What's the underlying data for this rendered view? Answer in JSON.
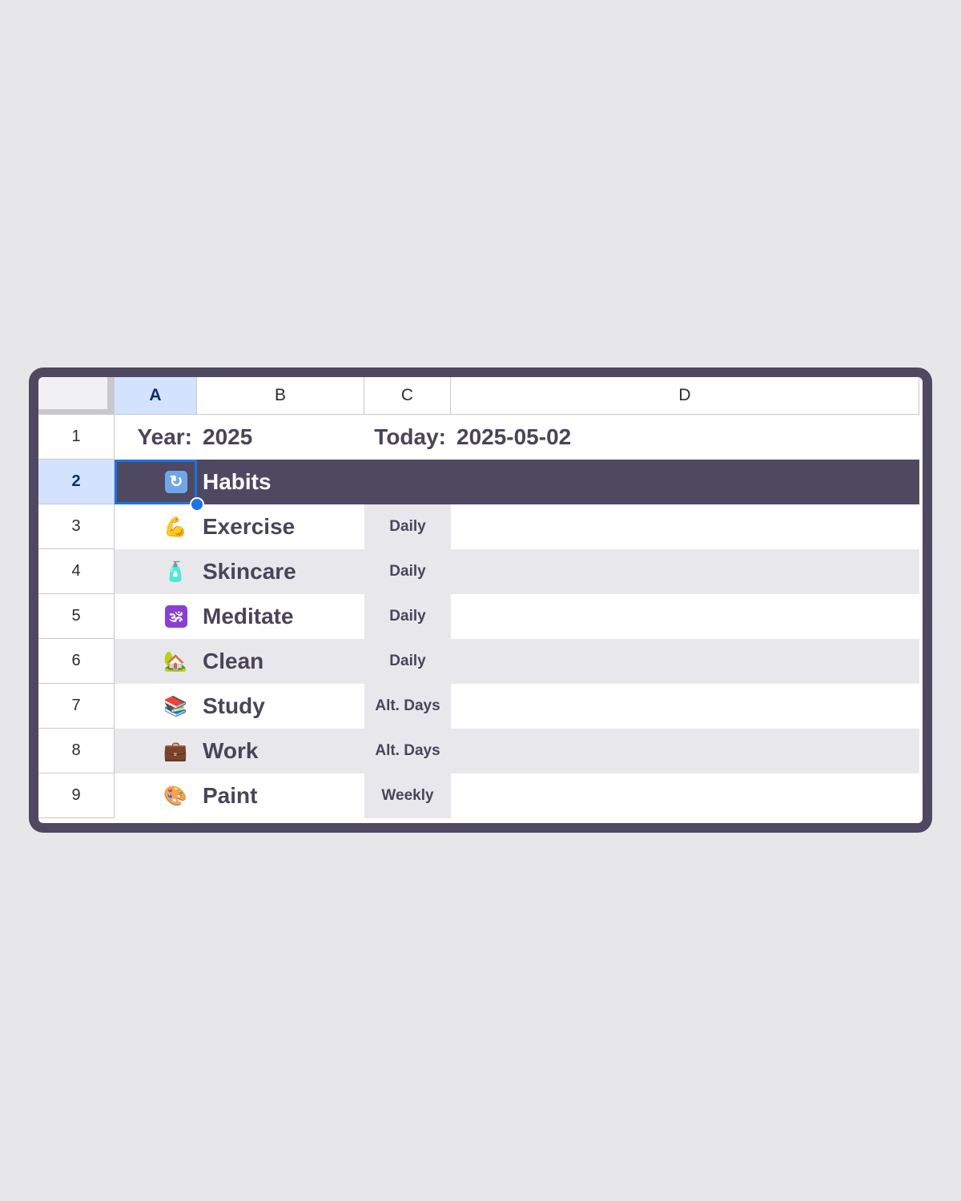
{
  "columns": [
    "A",
    "B",
    "C",
    "D"
  ],
  "rows": [
    "1",
    "2",
    "3",
    "4",
    "5",
    "6",
    "7",
    "8",
    "9"
  ],
  "header_row": {
    "year_label": "Year:",
    "year_value": "2025",
    "today_label": "Today:",
    "today_value": "2025-05-02"
  },
  "section": {
    "icon": "🔄",
    "title": "Habits"
  },
  "habits": [
    {
      "icon": "💪",
      "name": "Exercise",
      "frequency": "Daily"
    },
    {
      "icon": "🧴",
      "name": "Skincare",
      "frequency": "Daily"
    },
    {
      "icon": "🕉",
      "name": "Meditate",
      "frequency": "Daily"
    },
    {
      "icon": "🏡",
      "name": "Clean",
      "frequency": "Daily"
    },
    {
      "icon": "📚",
      "name": "Study",
      "frequency": "Alt. Days"
    },
    {
      "icon": "💼",
      "name": "Work",
      "frequency": "Alt. Days"
    },
    {
      "icon": "🎨",
      "name": "Paint",
      "frequency": "Weekly"
    }
  ],
  "colors": {
    "frame": "#4f4861",
    "text": "#4a4458",
    "selection": "#1a73e8",
    "header_active": "#d3e3fd",
    "alt_row": "#e8e8ec"
  }
}
